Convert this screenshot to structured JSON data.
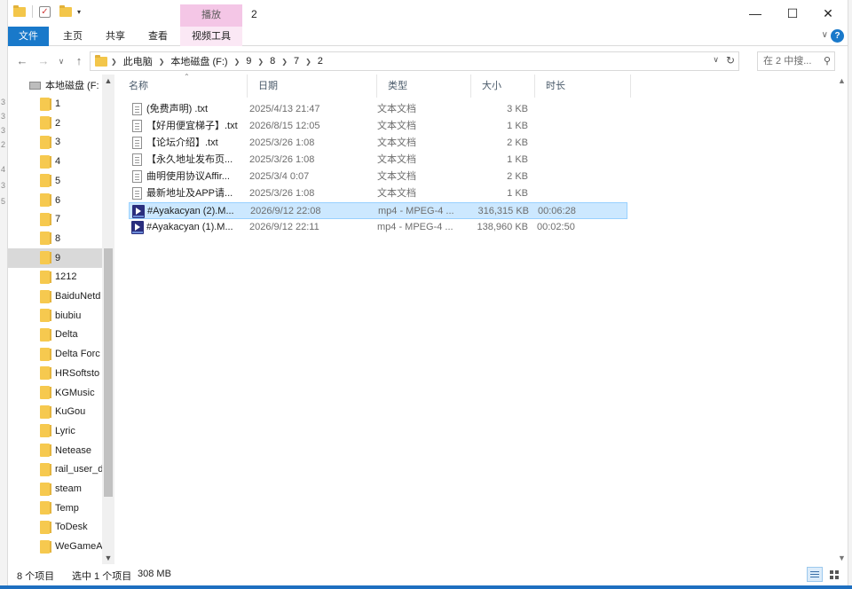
{
  "window": {
    "title": "2",
    "context_tab_header": "播放",
    "minimize_icon": "minimize-icon",
    "maximize_icon": "maximize-icon",
    "close_icon": "close-icon"
  },
  "ribbon": {
    "tabs": [
      {
        "label": "文件"
      },
      {
        "label": "主页"
      },
      {
        "label": "共享"
      },
      {
        "label": "查看"
      },
      {
        "label": "视频工具"
      }
    ],
    "help": "?"
  },
  "address": {
    "crumbs": [
      "此电脑",
      "本地磁盘 (F:)",
      "9",
      "8",
      "7",
      "2"
    ],
    "search_placeholder": "在 2 中搜...",
    "search_prefix_glyph": "在 2 中搜..."
  },
  "nav": {
    "root_label": "本地磁盘 (F:",
    "items": [
      {
        "label": "1"
      },
      {
        "label": "2"
      },
      {
        "label": "3"
      },
      {
        "label": "4"
      },
      {
        "label": "5"
      },
      {
        "label": "6"
      },
      {
        "label": "7"
      },
      {
        "label": "8"
      },
      {
        "label": "9",
        "selected": true
      },
      {
        "label": "1212"
      },
      {
        "label": "BaiduNetd"
      },
      {
        "label": "biubiu"
      },
      {
        "label": "Delta"
      },
      {
        "label": "Delta Forc"
      },
      {
        "label": "HRSoftsto"
      },
      {
        "label": "KGMusic"
      },
      {
        "label": "KuGou"
      },
      {
        "label": "Lyric"
      },
      {
        "label": "Netease"
      },
      {
        "label": "rail_user_d"
      },
      {
        "label": "steam"
      },
      {
        "label": "Temp"
      },
      {
        "label": "ToDesk"
      },
      {
        "label": "WeGameA"
      }
    ]
  },
  "columns": {
    "name": "名称",
    "date": "日期",
    "type": "类型",
    "size": "大小",
    "duration": "时长"
  },
  "files": [
    {
      "name": "(免费声明) .txt",
      "date": "2025/4/13 21:47",
      "type": "文本文档",
      "size": "3 KB",
      "duration": "",
      "icon": "text-file-icon"
    },
    {
      "name": "【好用便宜梯子】.txt",
      "date": "2026/8/15 12:05",
      "type": "文本文档",
      "size": "1 KB",
      "duration": "",
      "icon": "text-file-icon"
    },
    {
      "name": "【论坛介绍】.txt",
      "date": "2025/3/26 1:08",
      "type": "文本文档",
      "size": "2 KB",
      "duration": "",
      "icon": "text-file-icon"
    },
    {
      "name": "【永久地址发布页...",
      "date": "2025/3/26 1:08",
      "type": "文本文档",
      "size": "1 KB",
      "duration": "",
      "icon": "text-file-icon"
    },
    {
      "name": "曲明使用协议Affir...",
      "date": "2025/3/4 0:07",
      "type": "文本文档",
      "size": "2 KB",
      "duration": "",
      "icon": "text-file-icon"
    },
    {
      "name": "最新地址及APP请...",
      "date": "2025/3/26 1:08",
      "type": "文本文档",
      "size": "1 KB",
      "duration": "",
      "icon": "text-file-icon"
    },
    {
      "name": "#Ayakacyan (2).M...",
      "date": "2026/9/12 22:08",
      "type": "mp4 - MPEG-4 ...",
      "size": "316,315 KB",
      "duration": "00:06:28",
      "icon": "video-file-icon",
      "selected": true
    },
    {
      "name": "#Ayakacyan (1).M...",
      "date": "2026/9/12 22:11",
      "type": "mp4 - MPEG-4 ...",
      "size": "138,960 KB",
      "duration": "00:02:50",
      "icon": "video-file-icon"
    }
  ],
  "status": {
    "item_count": "8 个项目",
    "selected": "选中 1 个项目",
    "selected_size": "308 MB"
  },
  "colors": {
    "accent": "#1979ca",
    "selection_bg": "#cce8ff",
    "selection_border": "#99d1ff",
    "context_tab": "#f4c6e6",
    "folder": "#f6c94f"
  }
}
